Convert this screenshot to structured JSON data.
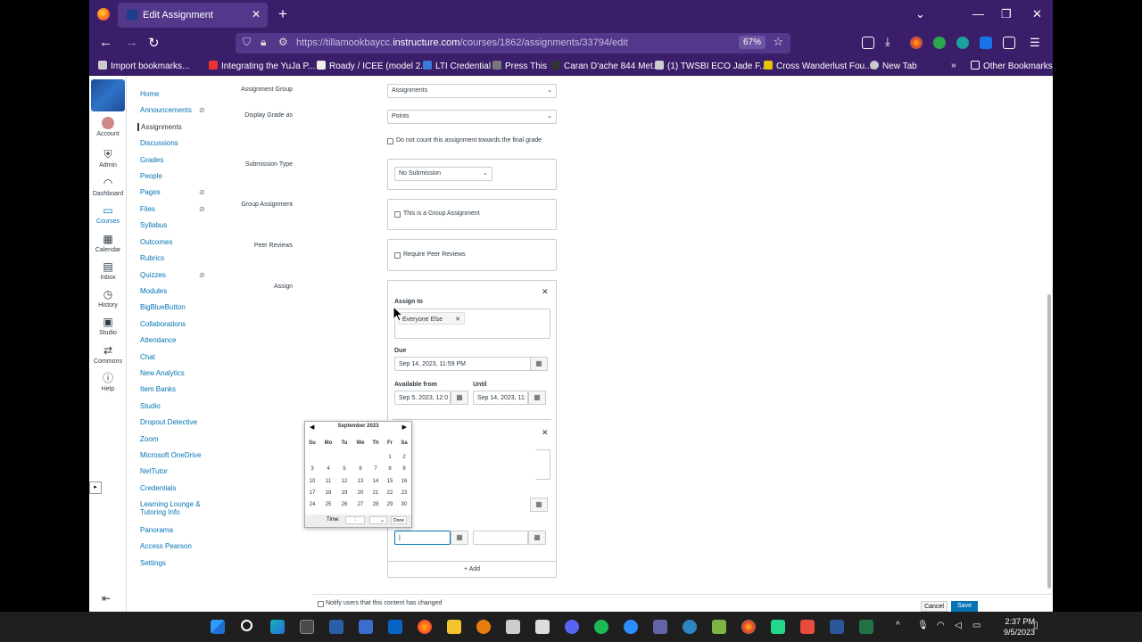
{
  "browser": {
    "tab_title": "Edit Assignment",
    "url_host_prefix": "https://tillamookbaycc.",
    "url_host": "instructure.com",
    "url_path": "/courses/1862/assignments/33794/edit",
    "zoom": "67%",
    "bookmarks": [
      "Import bookmarks...",
      "Integrating the YuJa P...",
      "Roady / ICEE (model 2...",
      "LTI Credential",
      "Press This",
      "Caran D'ache 844 Met...",
      "(1) TWSBI ECO Jade F...",
      "Cross Wanderlust Fou...",
      "New Tab"
    ],
    "other_bookmarks": "Other Bookmarks"
  },
  "global_nav": [
    {
      "label": "Account",
      "icon": "avatar-icon"
    },
    {
      "label": "Admin",
      "icon": "admin-icon"
    },
    {
      "label": "Dashboard",
      "icon": "dashboard-icon"
    },
    {
      "label": "Courses",
      "icon": "courses-icon"
    },
    {
      "label": "Calendar",
      "icon": "calendar-icon"
    },
    {
      "label": "Inbox",
      "icon": "inbox-icon"
    },
    {
      "label": "History",
      "icon": "history-icon"
    },
    {
      "label": "Studio",
      "icon": "studio-icon"
    },
    {
      "label": "Commons",
      "icon": "commons-icon"
    },
    {
      "label": "Help",
      "icon": "help-icon"
    }
  ],
  "course_nav": [
    {
      "label": "Home"
    },
    {
      "label": "Announcements",
      "hidden": true
    },
    {
      "label": "Assignments"
    },
    {
      "label": "Discussions"
    },
    {
      "label": "Grades"
    },
    {
      "label": "People"
    },
    {
      "label": "Pages",
      "hidden": true
    },
    {
      "label": "Files",
      "hidden": true
    },
    {
      "label": "Syllabus"
    },
    {
      "label": "Outcomes"
    },
    {
      "label": "Rubrics"
    },
    {
      "label": "Quizzes",
      "hidden": true
    },
    {
      "label": "Modules"
    },
    {
      "label": "BigBlueButton"
    },
    {
      "label": "Collaborations"
    },
    {
      "label": "Attendance"
    },
    {
      "label": "Chat"
    },
    {
      "label": "New Analytics"
    },
    {
      "label": "Item Banks"
    },
    {
      "label": "Studio"
    },
    {
      "label": "Dropout Detective"
    },
    {
      "label": "Zoom"
    },
    {
      "label": "Microsoft OneDrive"
    },
    {
      "label": "NetTutor"
    },
    {
      "label": "Credentials"
    },
    {
      "label": "Learning Lounge &"
    },
    {
      "label": "Tutoring Info"
    },
    {
      "label": "Panorama"
    },
    {
      "label": "Access Pearson"
    },
    {
      "label": "Settings"
    }
  ],
  "form": {
    "assignment_group_label": "Assignment Group",
    "assignment_group_value": "Assignments",
    "display_grade_label": "Display Grade as",
    "display_grade_value": "Points",
    "dont_count_label": "Do not count this assignment towards the final grade",
    "submission_type_label": "Submission Type",
    "submission_type_value": "No Submission",
    "group_assignment_label": "Group Assignment",
    "group_assignment_check": "This is a Group Assignment",
    "peer_reviews_label": "Peer Reviews",
    "peer_reviews_check": "Require Peer Reviews",
    "assign_label": "Assign",
    "assign_to_label": "Assign to",
    "assign_tag": "Everyone Else",
    "due_label": "Due",
    "due_value": "Sep 14, 2023, 11:59 PM",
    "available_from_label": "Available from",
    "available_from_value": "Sep 5, 2023, 12:0",
    "until_label": "Until",
    "until_value": "Sep 14, 2023, 11:",
    "add_label": "+ Add",
    "notify_label": "Notify users that this content has changed",
    "cancel_label": "Cancel",
    "save_label": "Save"
  },
  "datepicker": {
    "month": "September 2023",
    "dow": [
      "Su",
      "Mo",
      "Tu",
      "We",
      "Th",
      "Fr",
      "Sa"
    ],
    "weeks": [
      [
        "",
        "",
        "",
        "",
        "",
        "1",
        "2"
      ],
      [
        "3",
        "4",
        "5",
        "6",
        "7",
        "8",
        "9"
      ],
      [
        "10",
        "11",
        "12",
        "13",
        "14",
        "15",
        "16"
      ],
      [
        "17",
        "18",
        "19",
        "20",
        "21",
        "22",
        "23"
      ],
      [
        "24",
        "25",
        "26",
        "27",
        "28",
        "29",
        "30"
      ]
    ],
    "time_label": "Time:",
    "done_label": "Done"
  },
  "taskbar": {
    "time": "2:37 PM",
    "date": "9/5/2023"
  }
}
